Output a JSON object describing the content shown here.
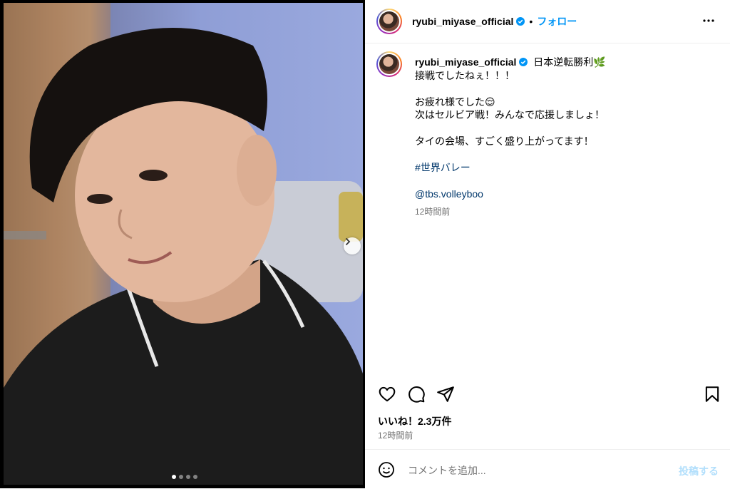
{
  "header": {
    "username": "ryubi_miyase_official",
    "separator": "•",
    "follow_label": "フォロー",
    "more_icon": "more-horizontal-icon"
  },
  "caption": {
    "username": "ryubi_miyase_official",
    "lines": [
      "日本逆転勝利🌿",
      "接戦でしたねぇ！！！",
      "",
      "お疲れ様でした😌",
      "次はセルビア戦！みんなで応援しましょ！",
      "",
      "タイの会場、すごく盛り上がってます！",
      "",
      "#世界バレー",
      "",
      "@tbs.volleyboo"
    ],
    "time_ago": "12時間前"
  },
  "actions": {
    "like_icon": "heart-icon",
    "comment_icon": "comment-icon",
    "share_icon": "send-icon",
    "save_icon": "bookmark-icon"
  },
  "likes_text": "いいね！2.3万件",
  "posted_time": "12時間前",
  "comment": {
    "placeholder": "コメントを追加...",
    "post_label": "投稿する",
    "emoji_icon": "smiley-icon"
  },
  "carousel": {
    "slide_count": 4,
    "active_index": 0
  },
  "colors": {
    "accent": "#0095f6",
    "link": "#00376b",
    "muted": "#737373",
    "post_disabled": "#b2dffc",
    "verified": "#0095f6"
  }
}
